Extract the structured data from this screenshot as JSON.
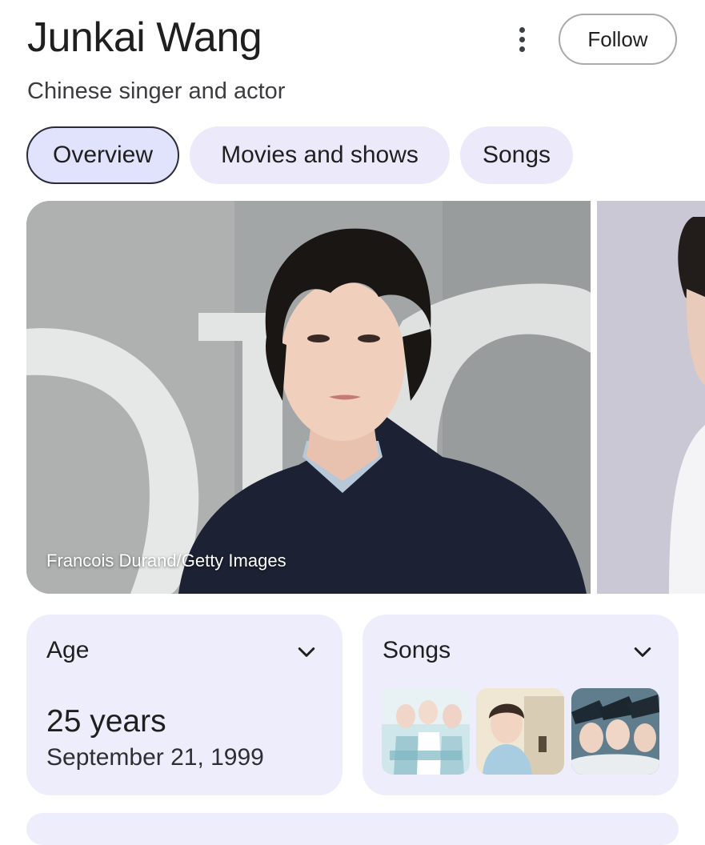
{
  "header": {
    "title": "Junkai Wang",
    "subtitle": "Chinese singer and actor",
    "more_icon": "more-vert-icon",
    "follow_label": "Follow"
  },
  "tabs": [
    {
      "label": "Overview",
      "active": true
    },
    {
      "label": "Movies and shows",
      "active": false
    },
    {
      "label": "Songs",
      "active": false
    }
  ],
  "hero": {
    "credit": "Francois Durand/Getty Images"
  },
  "cards": {
    "age": {
      "title": "Age",
      "value": "25 years",
      "date": "September 21, 1999",
      "icon": "chevron-down-icon"
    },
    "songs": {
      "title": "Songs",
      "icon": "chevron-down-icon",
      "thumbnails": [
        "album-cover-1",
        "album-cover-2",
        "album-cover-3"
      ]
    }
  },
  "colors": {
    "tab_active_bg": "#e1e3fc",
    "tab_bg": "#eceafa",
    "card_bg": "#eeedfb"
  }
}
